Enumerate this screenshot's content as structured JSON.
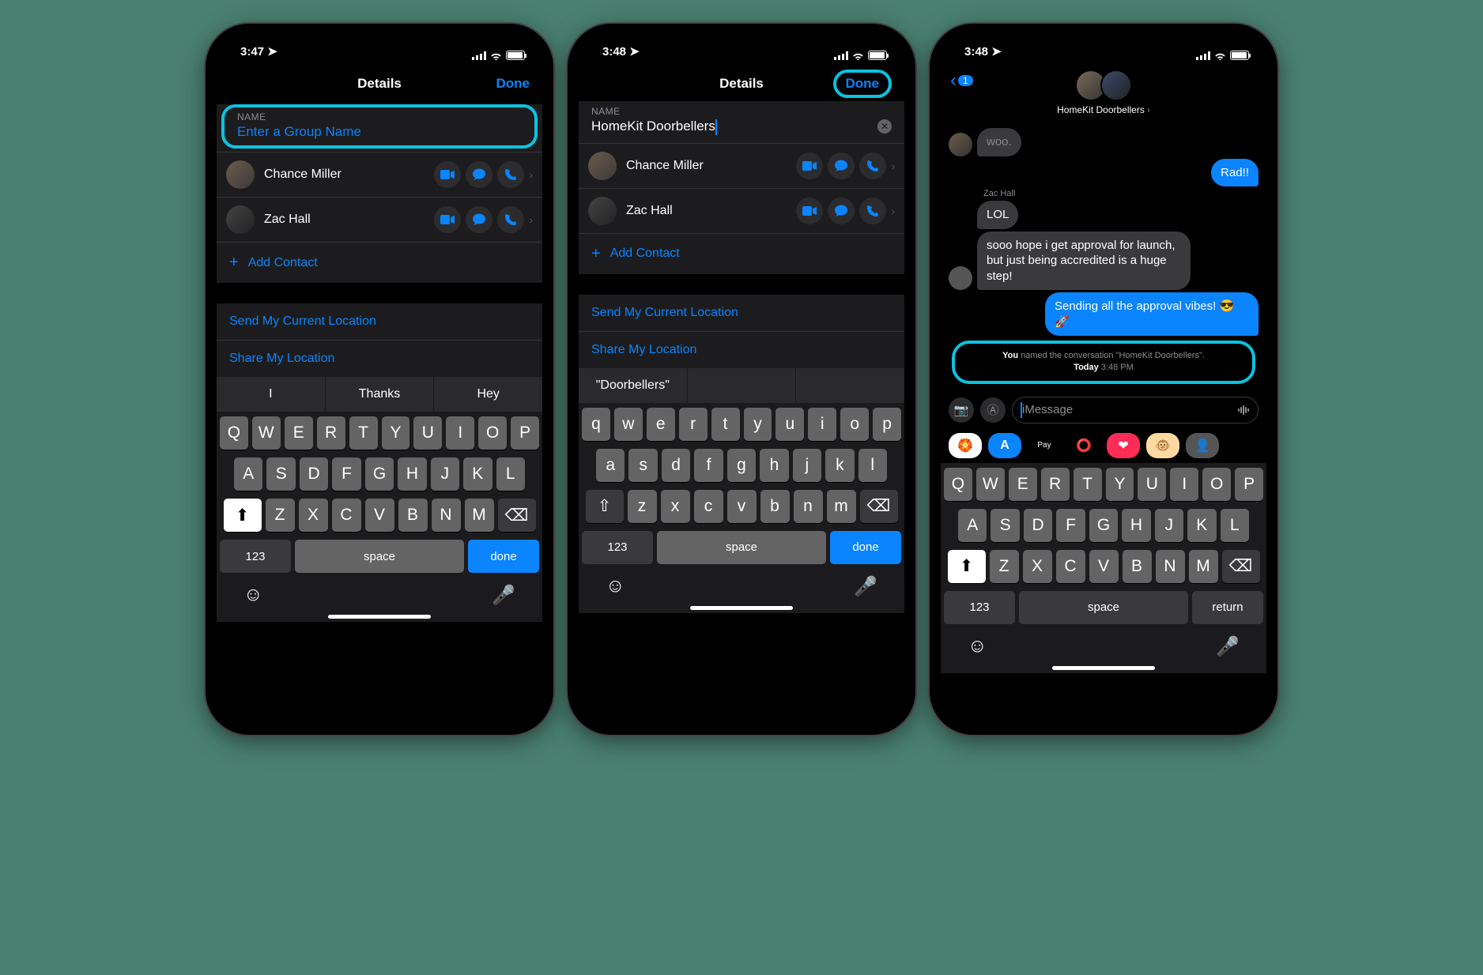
{
  "phones": [
    {
      "status": {
        "time": "3:47",
        "locArrow": true
      },
      "header": {
        "title": "Details",
        "done": "Done",
        "doneCircled": false,
        "nameCircled": true
      },
      "nameSection": {
        "label": "NAME",
        "placeholder": "Enter a Group Name",
        "value": "",
        "showClear": false
      },
      "contacts": [
        {
          "name": "Chance Miller"
        },
        {
          "name": "Zac Hall"
        }
      ],
      "addContact": "Add Contact",
      "links": [
        "Send My Current Location",
        "Share My Location"
      ],
      "suggestions": [
        "I",
        "Thanks",
        "Hey"
      ],
      "keyboard": {
        "case": "upper",
        "showShiftActive": true,
        "actionKey": "done"
      }
    },
    {
      "status": {
        "time": "3:48",
        "locArrow": true
      },
      "header": {
        "title": "Details",
        "done": "Done",
        "doneCircled": true,
        "nameCircled": false
      },
      "nameSection": {
        "label": "NAME",
        "placeholder": "",
        "value": "HomeKit Doorbellers",
        "showClear": true
      },
      "contacts": [
        {
          "name": "Chance Miller"
        },
        {
          "name": "Zac Hall"
        }
      ],
      "addContact": "Add Contact",
      "links": [
        "Send My Current Location",
        "Share My Location"
      ],
      "suggestions": [
        "\"Doorbellers\"",
        "",
        ""
      ],
      "keyboard": {
        "case": "lower",
        "showShiftActive": false,
        "actionKey": "done"
      }
    },
    {
      "status": {
        "time": "3:48",
        "locArrow": true
      },
      "conversation": {
        "backBadge": "1",
        "title": "HomeKit Doorbellers",
        "messages": [
          {
            "side": "right",
            "text": "Rad!!",
            "kind": "blue"
          },
          {
            "sender": "Zac Hall"
          },
          {
            "side": "left",
            "text": "LOL",
            "kind": "gray",
            "avatar": false
          },
          {
            "side": "left",
            "text": "sooo hope i get approval for launch, but just being accredited is a huge step!",
            "kind": "gray",
            "avatar": true
          },
          {
            "side": "right",
            "text": "Sending all the approval vibes! 😎 🚀",
            "kind": "blue"
          }
        ],
        "system": {
          "text": "You named the conversation \"HomeKit Doorbellers\".",
          "day": "Today",
          "time": "3:48 PM"
        },
        "inputPlaceholder": "iMessage"
      },
      "appTray": [
        {
          "bg": "#fff",
          "emoji": "🌈"
        },
        {
          "bg": "#0a84ff",
          "emoji": "A"
        },
        {
          "bg": "#000",
          "emoji": "Pay",
          "label": "Pay"
        },
        {
          "bg": "#000",
          "emoji": "⭕"
        },
        {
          "bg": "#ff2d55",
          "emoji": "❤"
        },
        {
          "bg": "#8e6a4a",
          "emoji": "🐵"
        },
        {
          "bg": "#555",
          "emoji": "👤"
        }
      ],
      "keyboard": {
        "case": "upper",
        "showShiftActive": true,
        "actionKey": "return"
      }
    }
  ],
  "icons": {
    "video": "video-icon",
    "message": "message-icon",
    "phone": "phone-icon"
  },
  "keys": {
    "row1U": [
      "Q",
      "W",
      "E",
      "R",
      "T",
      "Y",
      "U",
      "I",
      "O",
      "P"
    ],
    "row2U": [
      "A",
      "S",
      "D",
      "F",
      "G",
      "H",
      "J",
      "K",
      "L"
    ],
    "row3U": [
      "Z",
      "X",
      "C",
      "V",
      "B",
      "N",
      "M"
    ],
    "row1L": [
      "q",
      "w",
      "e",
      "r",
      "t",
      "y",
      "u",
      "i",
      "o",
      "p"
    ],
    "row2L": [
      "a",
      "s",
      "d",
      "f",
      "g",
      "h",
      "j",
      "k",
      "l"
    ],
    "row3L": [
      "z",
      "x",
      "c",
      "v",
      "b",
      "n",
      "m"
    ],
    "numKey": "123",
    "space": "space",
    "done": "done",
    "return": "return"
  }
}
